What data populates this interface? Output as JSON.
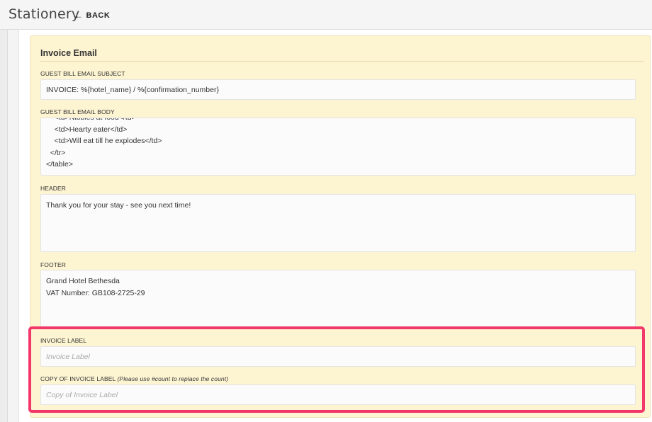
{
  "header": {
    "title": "Stationery",
    "back_label": "BACK"
  },
  "card": {
    "title": "Invoice Email",
    "subject": {
      "label": "GUEST BILL EMAIL SUBJECT",
      "value": "INVOICE: %{hotel_name} / %{confirmation_number}"
    },
    "body": {
      "label": "GUEST BILL EMAIL BODY",
      "lines": [
        "    <td>Nibbles at food</td>",
        "    <td>Hearty eater</td>",
        "    <td>Will eat till he explodes</td>",
        "  </tr>",
        "</table>"
      ]
    },
    "header_field": {
      "label": "HEADER",
      "value": "Thank you for your stay - see you next time!"
    },
    "footer_field": {
      "label": "FOOTER",
      "lines": [
        "Grand Hotel Bethesda",
        "VAT Number: GB108-2725-29"
      ]
    },
    "invoice_label": {
      "label": "INVOICE LABEL",
      "placeholder": "Invoice Label"
    },
    "copy_label": {
      "label": "COPY OF INVOICE LABEL",
      "hint": "(Please use #count to replace the count)",
      "placeholder": "Copy of Invoice Label"
    }
  },
  "colors": {
    "highlight": "#f2386a",
    "card_bg": "#fdf4d2"
  }
}
